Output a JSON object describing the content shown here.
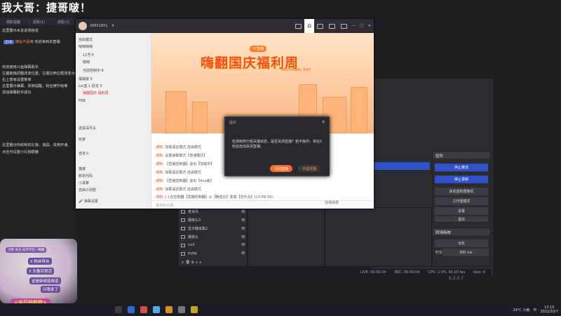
{
  "overlay_title": "我大哥：捷哥啵！",
  "left_panel": {
    "tabs": [
      "观影提醒",
      "观看(1)",
      "观看(2)"
    ],
    "lines": [
      "这里展示水友进场信息",
      "欢迎来到本直播",
      "欢迎使用斗鱼弹幕助手",
      "左键拖拽调整改变位置，左键拉伸边框改变大小",
      "右上角有设置菜单",
      "这里展示弹幕、贵族提醒、粉丝牌升级等",
      "添加弹幕助手成功",
      "这里展示你收到的礼物、道具、贵族开通、",
      "点击可设置小礼物屏蔽"
    ],
    "badge": "王HE",
    "badge_user": "御旨不是俺"
  },
  "live_window": {
    "room_id": "26651801",
    "fans": "4",
    "sidebar": [
      "自由模式",
      "哨哨哨哨",
      "11号卡",
      "暗哨",
      "当前控制中 8",
      "摆摆装 5",
      "Lin盒 1 卧龙 3",
      "嗨翻国庆 福利周",
      "FRB",
      "选溪深月夫",
      "玩家",
      "自定义",
      "猫宴",
      "新拍代码",
      "小溪宴",
      "自由小别墅"
    ],
    "banner_tag": "YY直播",
    "banner_title": "嗨翻国庆福利周",
    "banner_sub": "NATIONAL DAY",
    "chat": [
      {
        "who": "通知:",
        "text": "加载语言模式 自由模式"
      },
      {
        "who": "通知:",
        "text": "设置弹幕模式【普通模式】"
      },
      {
        "who": "通知:",
        "text": "【直播控制器】退出【加载中】"
      },
      {
        "who": "通知:",
        "text": "加载语言模式 自由模式"
      },
      {
        "who": "通知:",
        "text": "【直播控制器】退出【dou鱼】"
      },
      {
        "who": "通知:",
        "text": "加载语言模式 自由模式"
      },
      {
        "who": "通知:",
        "text": "[-] 在控制器【直播控制器】从【静音台】变成【音乐台】(13:09:19)"
      }
    ],
    "chat_placeholder": "说点什么吧...",
    "bottom_tools": [
      "弹幕设置",
      "在线状态"
    ]
  },
  "dialog": {
    "title": "提示",
    "message": "检测到你已经关播状态，是否关闭直播？若不操作，将在5秒后自动关闭直播。",
    "confirm": "关闭直播",
    "cancel": "不需关播"
  },
  "obs": {
    "controls_title": "控件",
    "controls": [
      "停止推流",
      "停止录制",
      "启动虚拟摄像机",
      "工作室模式",
      "设置",
      "退出"
    ],
    "transitions_title": "转场特效",
    "transition_type": "淡化",
    "duration_label": "时长",
    "duration_value": "300 ms",
    "sources": [
      "麦克风",
      "摄像头3",
      "显示器采集2",
      "摄像头",
      "null",
      "pubg"
    ],
    "status_live": "LIVE: 00:00:04",
    "status_rec": "REC: 00:00:04",
    "status_cpu": "CPU: 2.0%, 60.00 fps",
    "status_kbps": "kb/s: 0",
    "version": "6.2.0.7"
  },
  "mascot": {
    "top_text": "点赞 关注 投币不吃一颗糖",
    "tag1": "X 粉丝带合",
    "tag2": "X 头像目常活",
    "tag3": "这是新频道频道",
    "tag4": "问我来了",
    "today": "<今日份拾捡>"
  },
  "taskbar": {
    "weather": "24°C 小雨",
    "lang": "中",
    "time": "13:10",
    "date": "2022/10/7"
  }
}
